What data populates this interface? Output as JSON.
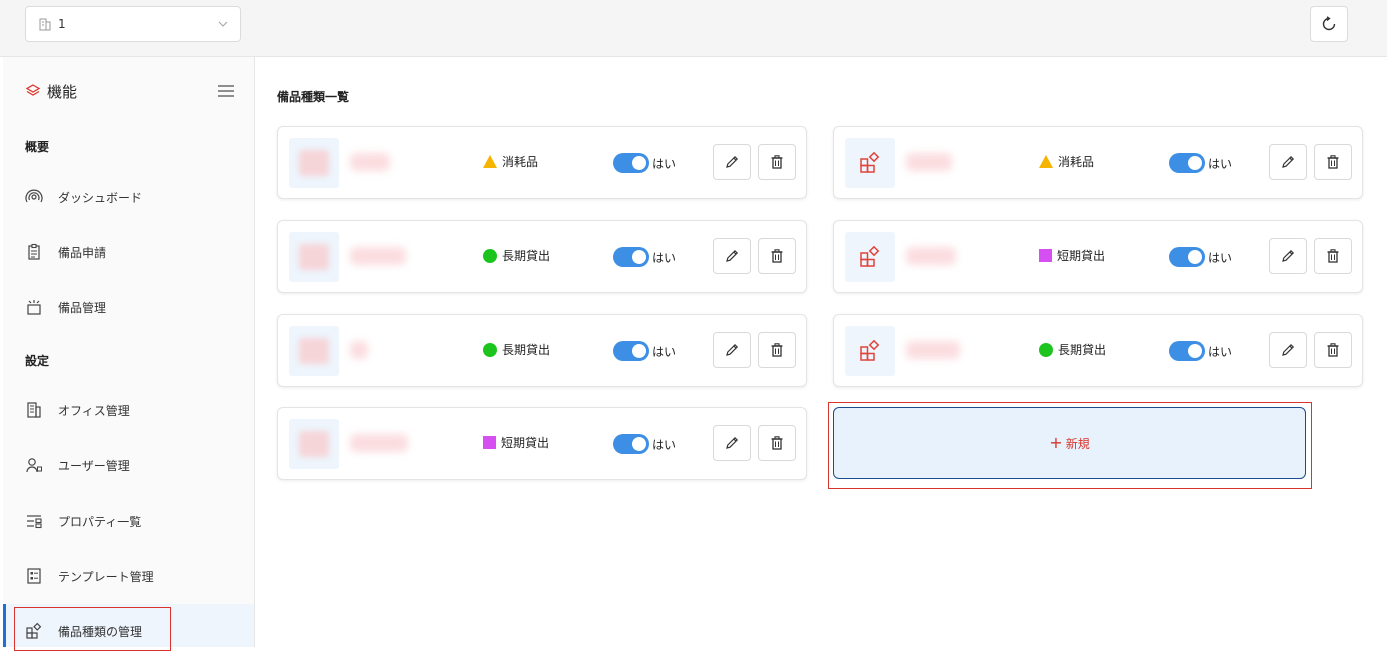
{
  "topbar": {
    "office_value": "1",
    "icons": {
      "office": "building-icon",
      "chevron": "chevron-down-icon",
      "refresh": "refresh-icon"
    }
  },
  "sidebar": {
    "title": "機能",
    "sections": [
      {
        "label": "概要",
        "items": [
          {
            "label": "ダッシュボード",
            "icon": "dashboard-icon"
          },
          {
            "label": "備品申請",
            "icon": "clipboard-icon"
          },
          {
            "label": "備品管理",
            "icon": "equipment-icon"
          }
        ]
      },
      {
        "label": "設定",
        "items": [
          {
            "label": "オフィス管理",
            "icon": "building-icon"
          },
          {
            "label": "ユーザー管理",
            "icon": "user-icon"
          },
          {
            "label": "プロパティ一覧",
            "icon": "sliders-icon"
          },
          {
            "label": "テンプレート管理",
            "icon": "template-icon"
          },
          {
            "label": "備品種類の管理",
            "icon": "categories-icon",
            "active": true
          }
        ]
      }
    ]
  },
  "main": {
    "title": "備品種類一覧",
    "toggle_label": "はい",
    "add_label": "新規",
    "categories": [
      {
        "category": "消耗品",
        "shape": "triangle",
        "color": "#f4b400",
        "enabled": true,
        "thumb": "blurred"
      },
      {
        "category": "消耗品",
        "shape": "triangle",
        "color": "#f4b400",
        "enabled": true,
        "thumb": "category-icon"
      },
      {
        "category": "長期貸出",
        "shape": "circle",
        "color": "#1ec41e",
        "enabled": true,
        "thumb": "blurred"
      },
      {
        "category": "短期貸出",
        "shape": "square",
        "color": "#d64ff0",
        "enabled": true,
        "thumb": "category-icon"
      },
      {
        "category": "長期貸出",
        "shape": "circle",
        "color": "#1ec41e",
        "enabled": true,
        "thumb": "blurred"
      },
      {
        "category": "長期貸出",
        "shape": "circle",
        "color": "#1ec41e",
        "enabled": true,
        "thumb": "category-icon"
      },
      {
        "category": "短期貸出",
        "shape": "square",
        "color": "#d64ff0",
        "enabled": true,
        "thumb": "blurred"
      }
    ]
  },
  "colors": {
    "accent": "#3d8fe6",
    "danger": "#d9342b",
    "active_bg": "#eef5fd"
  }
}
